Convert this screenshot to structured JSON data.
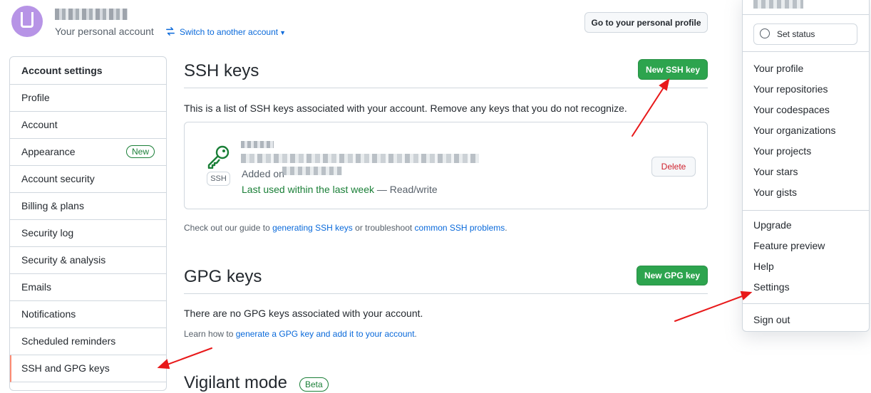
{
  "header": {
    "account_subtitle": "Your personal account",
    "switch_label": "Switch to another account",
    "profile_button": "Go to your personal profile"
  },
  "sidebar": {
    "heading": "Account settings",
    "items": [
      {
        "label": "Profile"
      },
      {
        "label": "Account"
      },
      {
        "label": "Appearance",
        "badge": "New"
      },
      {
        "label": "Account security"
      },
      {
        "label": "Billing & plans"
      },
      {
        "label": "Security log"
      },
      {
        "label": "Security & analysis"
      },
      {
        "label": "Emails"
      },
      {
        "label": "Notifications"
      },
      {
        "label": "Scheduled reminders"
      },
      {
        "label": "SSH and GPG keys",
        "selected": true
      }
    ]
  },
  "ssh": {
    "title": "SSH keys",
    "new_button": "New SSH key",
    "description": "This is a list of SSH keys associated with your account. Remove any keys that you do not recognize.",
    "key_type": "SSH",
    "added_prefix": "Added on",
    "last_used": "Last used within the last week",
    "access": " — Read/write",
    "delete_button": "Delete",
    "guide_prefix": "Check out our guide to ",
    "guide_link1": "generating SSH keys",
    "guide_middle": " or troubleshoot ",
    "guide_link2": "common SSH problems",
    "guide_suffix": "."
  },
  "gpg": {
    "title": "GPG keys",
    "new_button": "New GPG key",
    "description": "There are no GPG keys associated with your account.",
    "learn_prefix": "Learn how to ",
    "learn_link": "generate a GPG key and add it to your account",
    "learn_suffix": "."
  },
  "vigilant": {
    "title": "Vigilant mode",
    "badge": "Beta"
  },
  "dropdown": {
    "set_status": "Set status",
    "group1": [
      "Your profile",
      "Your repositories",
      "Your codespaces",
      "Your organizations",
      "Your projects",
      "Your stars",
      "Your gists"
    ],
    "group2": [
      "Upgrade",
      "Feature preview",
      "Help",
      "Settings"
    ],
    "sign_out": "Sign out"
  },
  "colors": {
    "accent_green": "#2da44e",
    "link_blue": "#0969da",
    "selected_marker": "#fd8c73",
    "annotation_arrow": "#e8191a",
    "danger_red": "#cf222e"
  }
}
